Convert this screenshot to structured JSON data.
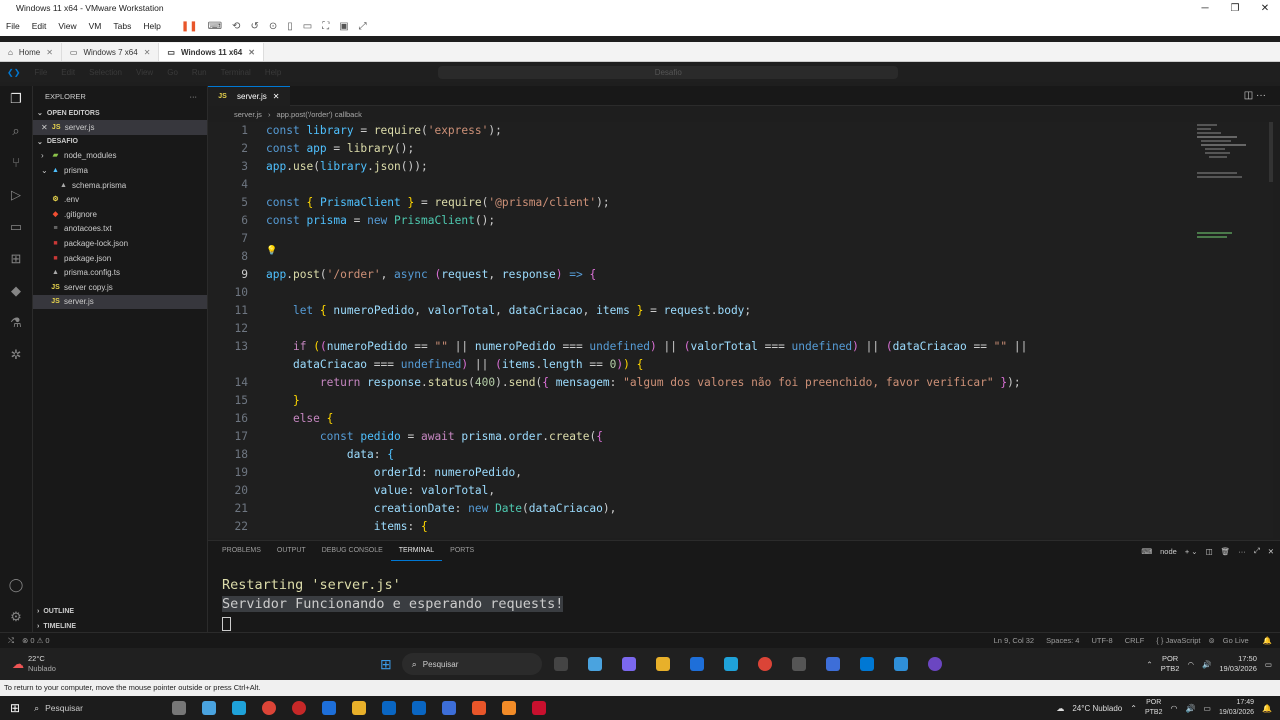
{
  "vm": {
    "title": "Windows 11 x64 - VMware Workstation",
    "menu": [
      "File",
      "Edit",
      "View",
      "VM",
      "Tabs",
      "Help"
    ],
    "tabs": [
      {
        "label": "Home"
      },
      {
        "label": "Windows 7 x64"
      },
      {
        "label": "Windows 11 x64"
      }
    ]
  },
  "vscode": {
    "menu": [
      "File",
      "Edit",
      "Selection",
      "View",
      "Go",
      "Run",
      "Terminal",
      "Help"
    ],
    "search": "Desafio",
    "sidebar": {
      "header": "EXPLORER",
      "open_editors": "OPEN EDITORS",
      "open_file": "server.js",
      "project": "DESAFIO",
      "tree": [
        {
          "label": "node_modules",
          "type": "folder"
        },
        {
          "label": "prisma",
          "type": "folder-open"
        },
        {
          "label": "schema.prisma",
          "type": "prisma"
        },
        {
          "label": ".env",
          "type": "env"
        },
        {
          "label": ".gitignore",
          "type": "git"
        },
        {
          "label": "anotacoes.txt",
          "type": "txt"
        },
        {
          "label": "package-lock.json",
          "type": "npm"
        },
        {
          "label": "package.json",
          "type": "npm"
        },
        {
          "label": "prisma.config.ts",
          "type": "prisma"
        },
        {
          "label": "server copy.js",
          "type": "js"
        },
        {
          "label": "server.js",
          "type": "js"
        }
      ],
      "outline": "OUTLINE",
      "timeline": "TIMELINE"
    },
    "editor_tab": "server.js",
    "breadcrumb": [
      "server.js",
      "app.post('/order') callback"
    ],
    "panel": {
      "tabs": [
        "PROBLEMS",
        "OUTPUT",
        "DEBUG CONSOLE",
        "TERMINAL",
        "PORTS"
      ],
      "active": "TERMINAL",
      "terminal_name": "node",
      "lines": [
        "Restarting 'server.js'",
        "Servidor Funcionando e esperando requests!"
      ]
    },
    "status": {
      "errors": "⊗ 0 ⚠ 0",
      "position": "Ln 9, Col 32",
      "spaces": "Spaces: 4",
      "encoding": "UTF-8",
      "eol": "CRLF",
      "language": "{ } JavaScript",
      "golive": "Go Live"
    }
  },
  "guest_taskbar": {
    "weather_temp": "22°C",
    "weather_text": "Nublado",
    "search": "Pesquisar",
    "lang": "POR",
    "lang2": "PTB2",
    "time": "17:50",
    "date": "19/03/2026"
  },
  "hint": "To return to your computer, move the mouse pointer outside or press Ctrl+Alt.",
  "host_taskbar": {
    "search": "Pesquisar",
    "weather": "24°C Nublado",
    "lang": "POR",
    "lang2": "PTB2",
    "time": "17:49",
    "date": "19/03/2026"
  }
}
